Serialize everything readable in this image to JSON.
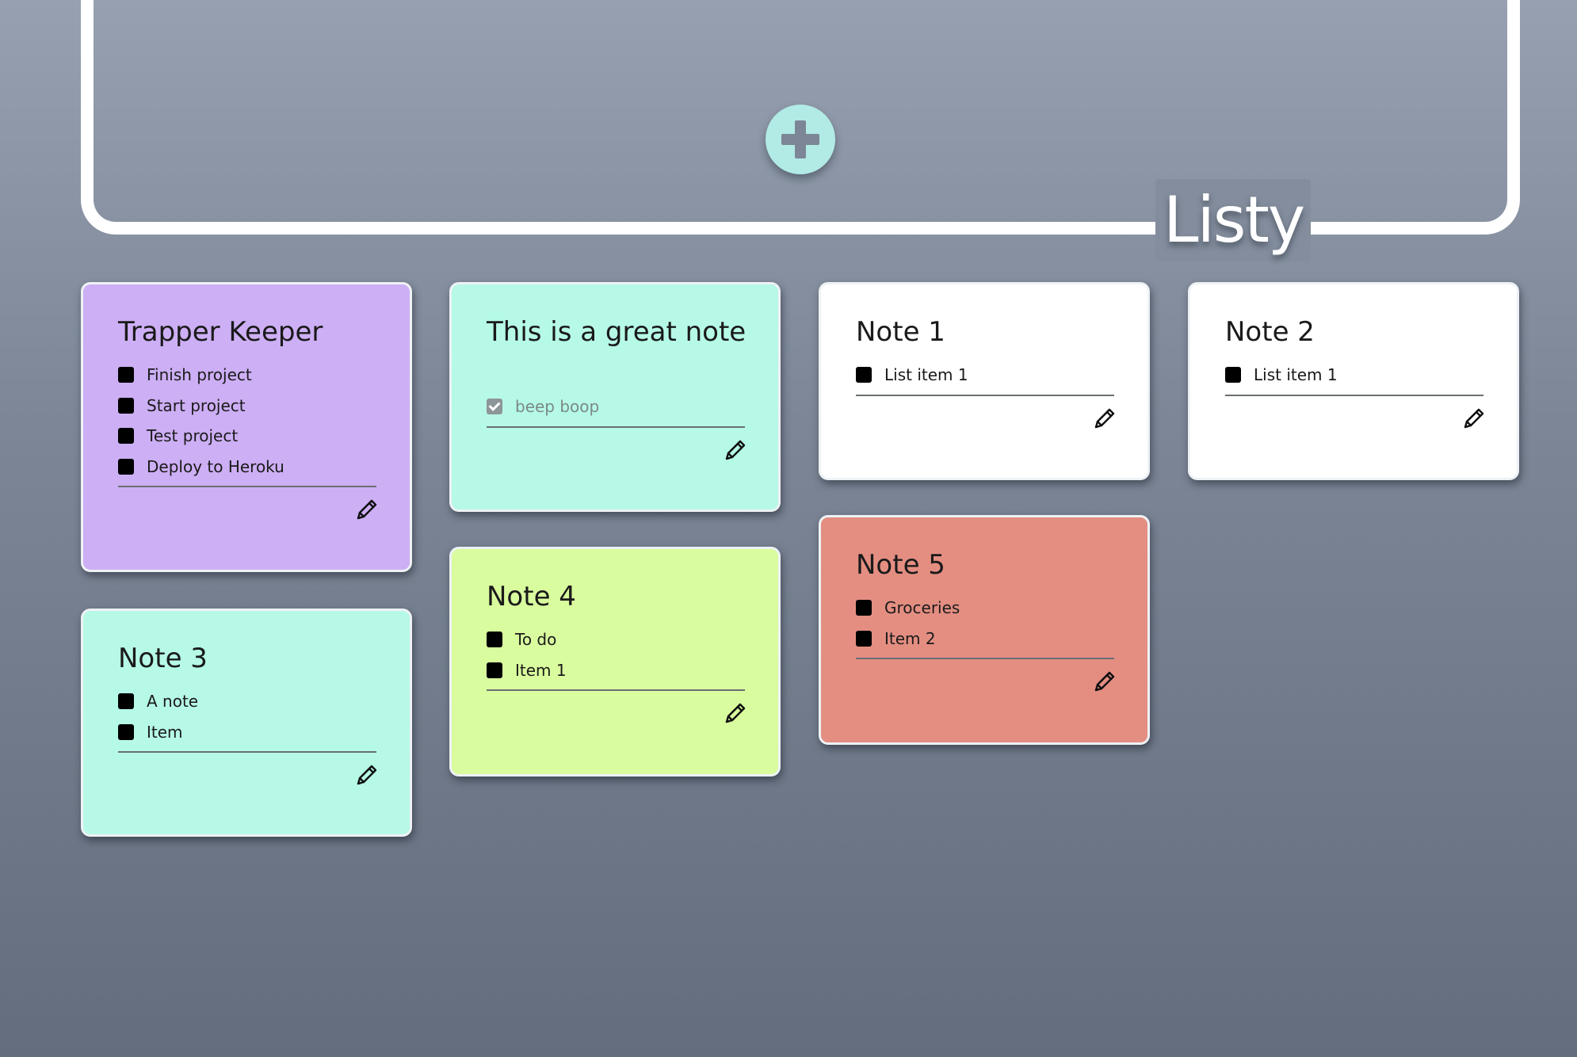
{
  "app": {
    "title": "Listy",
    "add_button_icon": "plus-icon"
  },
  "colors": {
    "purple": "#cdaff5",
    "aqua": "#b6f9e7",
    "white": "#ffffff",
    "lime": "#d9fc9e",
    "salmon": "#e48e82"
  },
  "notes": [
    {
      "title": "Trapper Keeper",
      "color": "#cdaff5",
      "items": [
        {
          "text": "Finish project",
          "checked": false
        },
        {
          "text": "Start project",
          "checked": false
        },
        {
          "text": "Test project",
          "checked": false
        },
        {
          "text": "Deploy to Heroku",
          "checked": false
        }
      ]
    },
    {
      "title": "This is a great note",
      "color": "#b6f9e7",
      "items": [
        {
          "text": "beep boop",
          "checked": true
        }
      ]
    },
    {
      "title": "Note 1",
      "color": "#ffffff",
      "items": [
        {
          "text": "List item 1",
          "checked": false
        }
      ]
    },
    {
      "title": "Note 2",
      "color": "#ffffff",
      "items": [
        {
          "text": "List item 1",
          "checked": false
        }
      ]
    },
    {
      "title": "Note 3",
      "color": "#b6f9e7",
      "items": [
        {
          "text": "A note",
          "checked": false
        },
        {
          "text": "Item",
          "checked": false
        }
      ]
    },
    {
      "title": "Note 4",
      "color": "#d9fc9e",
      "items": [
        {
          "text": "To do",
          "checked": false
        },
        {
          "text": "Item 1",
          "checked": false
        }
      ]
    },
    {
      "title": "Note 5",
      "color": "#e48e82",
      "items": [
        {
          "text": "Groceries",
          "checked": false
        },
        {
          "text": "Item 2",
          "checked": false
        }
      ]
    }
  ],
  "icons": {
    "edit": "pencil-icon",
    "checked": "checkmark-icon"
  }
}
